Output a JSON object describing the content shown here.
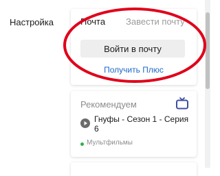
{
  "sidebar": {
    "settings_label": "Настройка"
  },
  "mail_widget": {
    "tabs": [
      {
        "label": "Почта",
        "active": true
      },
      {
        "label": "Завести почту",
        "active": false
      }
    ],
    "login_button": "Войти в почту",
    "plus_link": "Получить Плюс"
  },
  "recommend_widget": {
    "title": "Рекомендуем",
    "icon": "tv-icon",
    "item": {
      "icon": "play-icon",
      "title": "Гнуфы - Сезон 1 - Серия 6",
      "genre": "Мультфильмы"
    }
  },
  "colors": {
    "link": "#2169c9",
    "annotation": "#e0001a",
    "genre_dot": "#2bb24c"
  }
}
